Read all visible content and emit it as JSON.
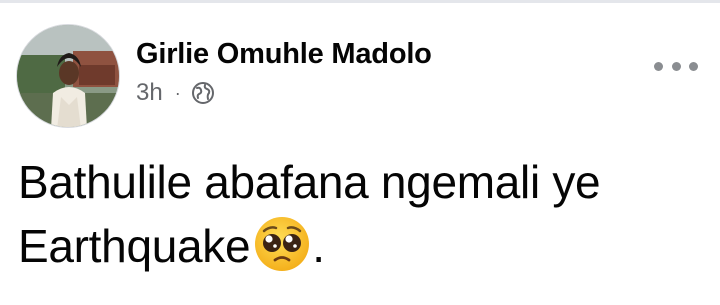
{
  "post": {
    "author_name": "Girlie Omuhle Madolo",
    "timestamp": "3h",
    "separator": "·",
    "audience_icon": "globe-icon",
    "more_icon": "more-horizontal-icon",
    "text_line1": "Bathulile abafana ngemali ye",
    "text_line2": "Earthquake",
    "text_end": ".",
    "emoji_icon": "pleading-face-emoji-icon"
  },
  "colors": {
    "name": "#050505",
    "meta": "#65676b",
    "more_dots": "#8a8d91",
    "emoji_face": "#f9c230",
    "divider": "#e4e6eb"
  }
}
